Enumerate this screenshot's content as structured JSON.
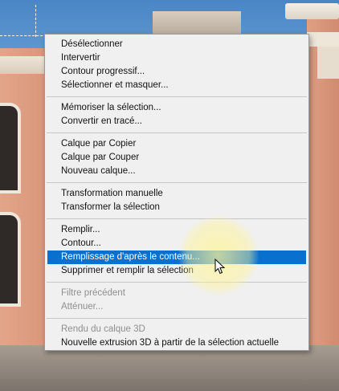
{
  "menu": {
    "groups": [
      {
        "items": [
          {
            "label": "Désélectionner"
          },
          {
            "label": "Intervertir"
          },
          {
            "label": "Contour progressif..."
          },
          {
            "label": "Sélectionner et masquer..."
          }
        ]
      },
      {
        "items": [
          {
            "label": "Mémoriser la sélection..."
          },
          {
            "label": "Convertir en tracé..."
          }
        ]
      },
      {
        "items": [
          {
            "label": "Calque par Copier"
          },
          {
            "label": "Calque par Couper"
          },
          {
            "label": "Nouveau calque..."
          }
        ]
      },
      {
        "items": [
          {
            "label": "Transformation manuelle"
          },
          {
            "label": "Transformer la sélection"
          }
        ]
      },
      {
        "items": [
          {
            "label": "Remplir..."
          },
          {
            "label": "Contour..."
          },
          {
            "label": "Remplissage d'après le contenu..."
          },
          {
            "label": "Supprimer et remplir la sélection"
          }
        ]
      },
      {
        "items": [
          {
            "label": "Filtre précédent"
          },
          {
            "label": "Atténuer..."
          }
        ]
      },
      {
        "items": [
          {
            "label": "Rendu du calque 3D"
          },
          {
            "label": "Nouvelle extrusion 3D à partir de la sélection actuelle"
          }
        ]
      }
    ],
    "highlight_color": "#0a70d0"
  },
  "cursor": {
    "icon": "arrow-cursor-icon"
  }
}
